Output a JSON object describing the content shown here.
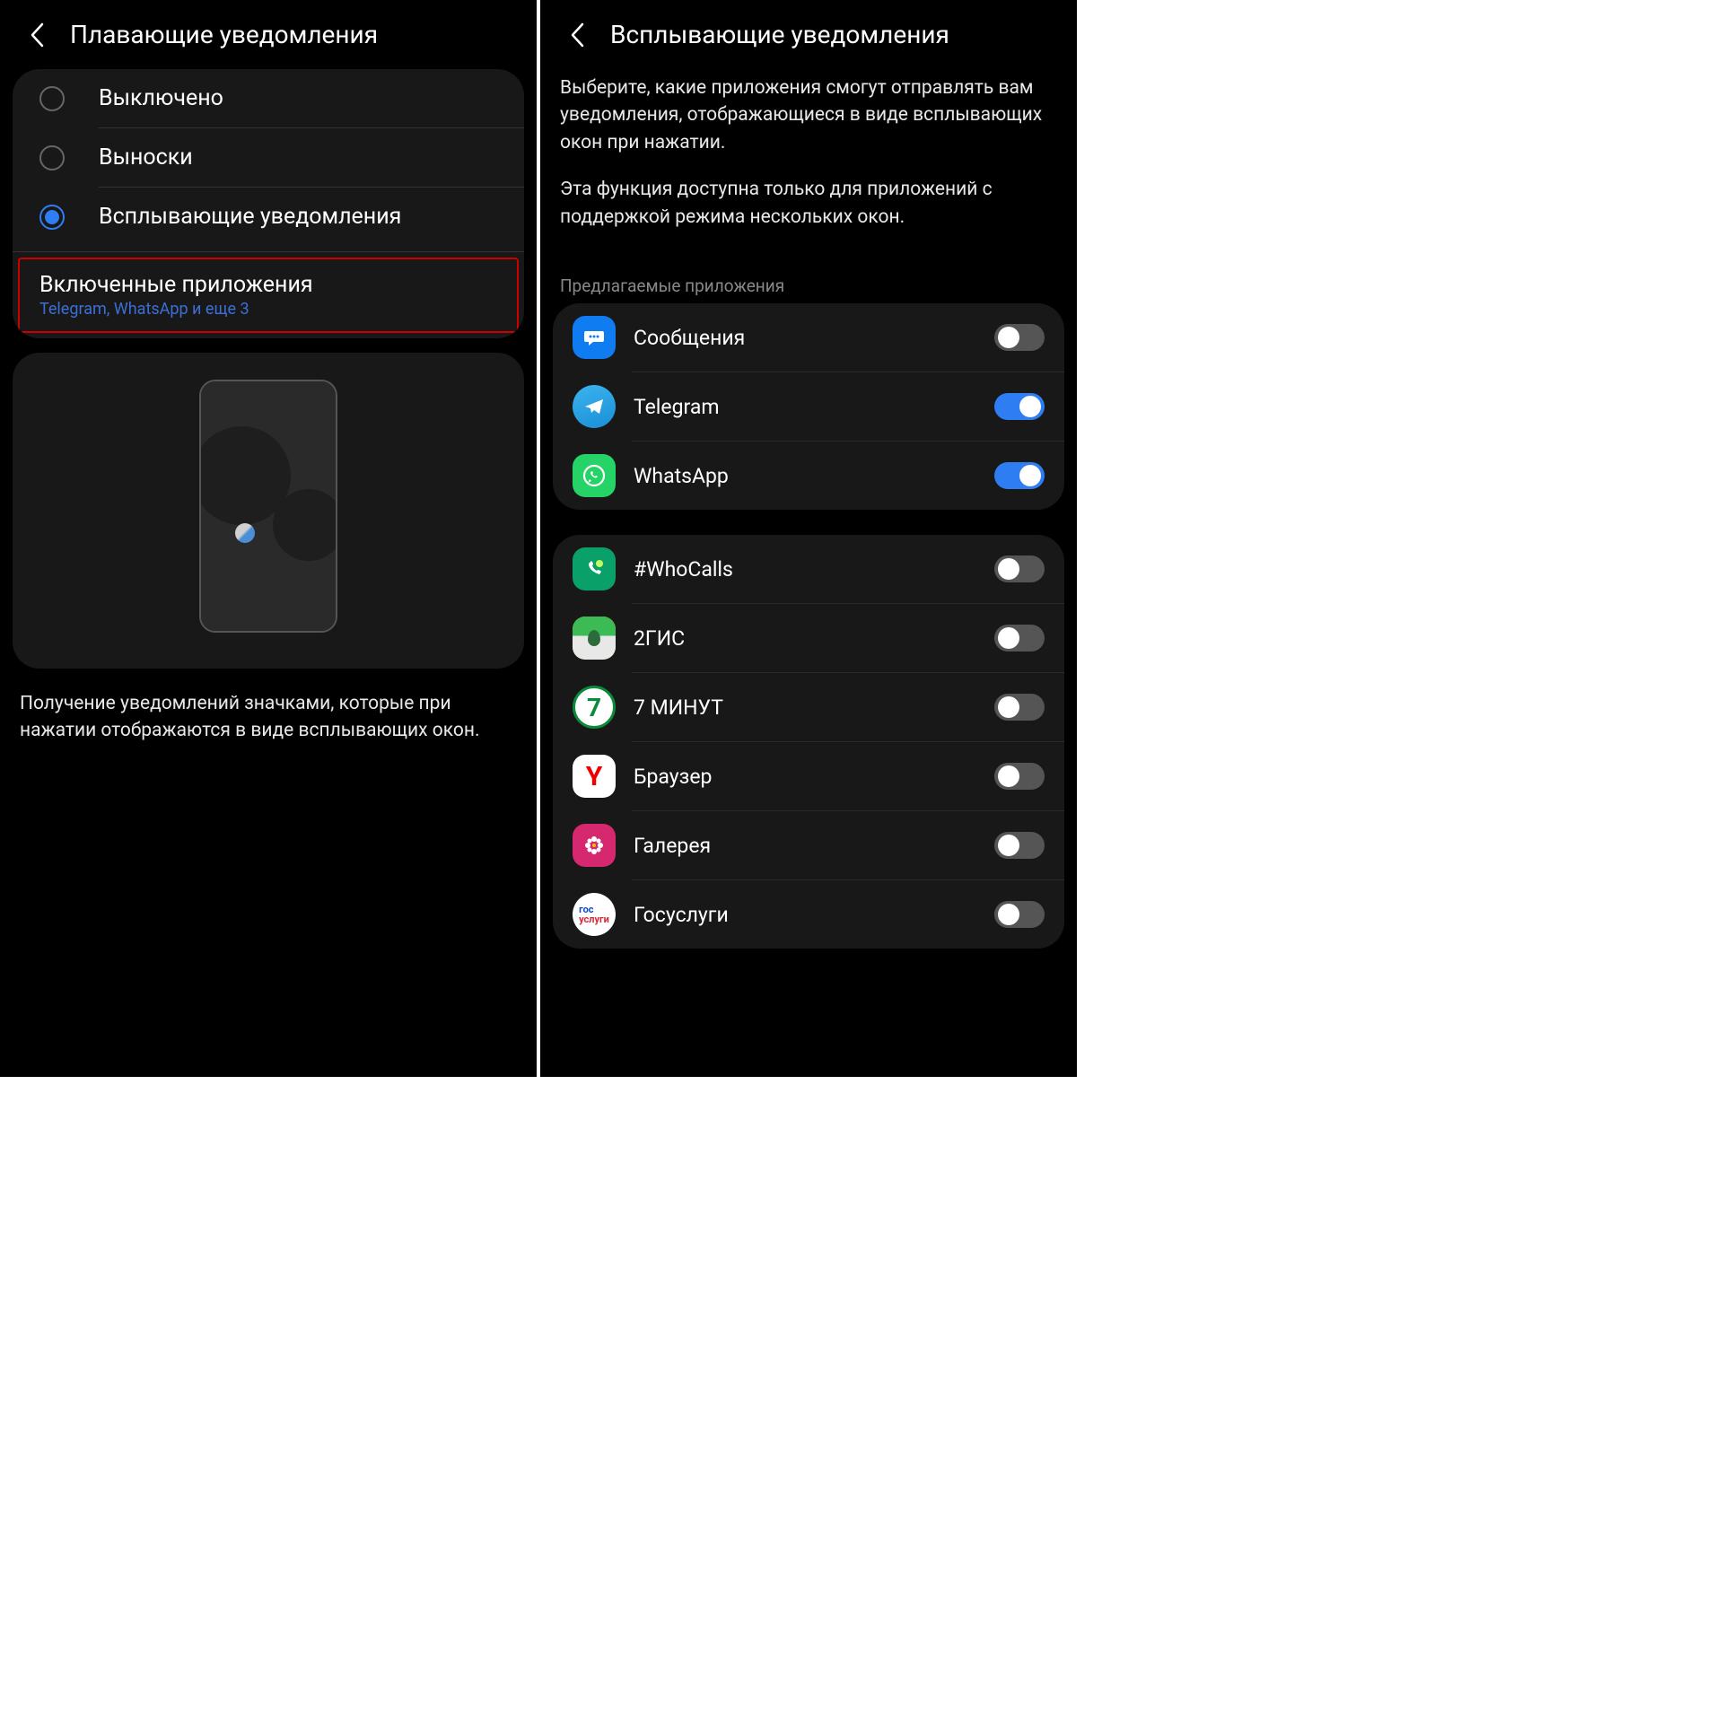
{
  "left": {
    "title": "Плавающие уведомления",
    "radios": [
      {
        "label": "Выключено",
        "selected": false
      },
      {
        "label": "Выноски",
        "selected": false
      },
      {
        "label": "Всплывающие уведомления",
        "selected": true
      }
    ],
    "enabled": {
      "title": "Включенные приложения",
      "subtitle": "Telegram, WhatsApp и еще 3"
    },
    "description": "Получение уведомлений значками, которые при нажатии отображаются в виде всплывающих окон."
  },
  "right": {
    "title": "Всплывающие уведомления",
    "intro1": "Выберите, какие приложения смогут отправлять вам уведомления, отображающиеся в виде всплывающих окон при нажатии.",
    "intro2": "Эта функция доступна только для приложений с поддержкой режима нескольких окон.",
    "section": "Предлагаемые приложения",
    "suggested": [
      {
        "name": "Сообщения",
        "on": false,
        "icon": "messages"
      },
      {
        "name": "Telegram",
        "on": true,
        "icon": "telegram"
      },
      {
        "name": "WhatsApp",
        "on": true,
        "icon": "whatsapp"
      }
    ],
    "apps": [
      {
        "name": "#WhoCalls",
        "on": false,
        "icon": "whocalls"
      },
      {
        "name": "2ГИС",
        "on": false,
        "icon": "2gis"
      },
      {
        "name": "7 МИНУТ",
        "on": false,
        "icon": "7min"
      },
      {
        "name": "Браузер",
        "on": false,
        "icon": "yandex"
      },
      {
        "name": "Галерея",
        "on": false,
        "icon": "gallery"
      },
      {
        "name": "Госуслуги",
        "on": false,
        "icon": "gosuslugi"
      }
    ]
  }
}
